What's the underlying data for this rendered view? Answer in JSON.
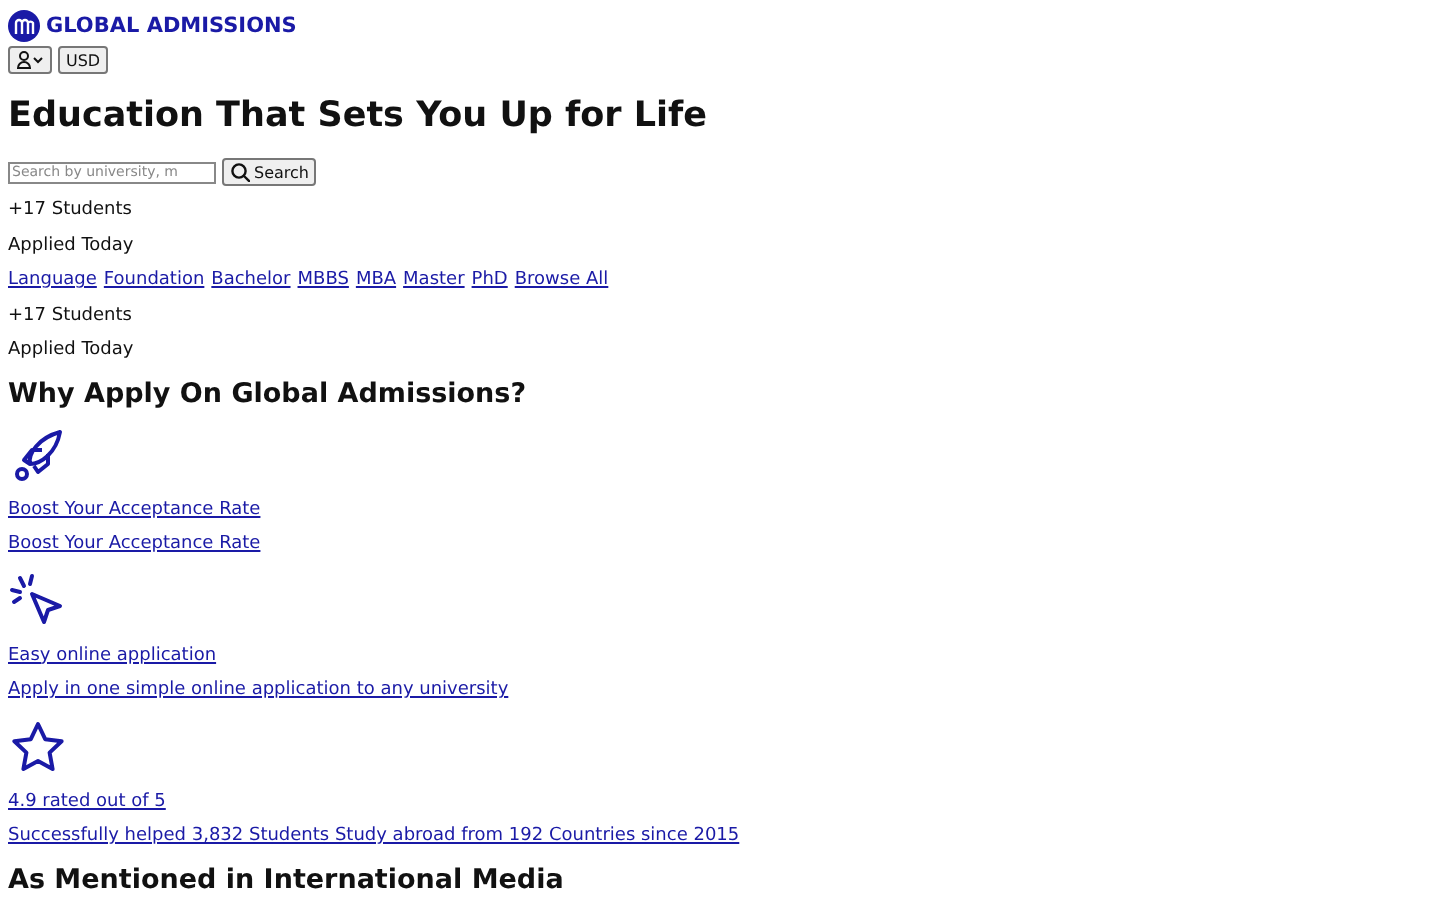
{
  "brand": {
    "name": "GLOBAL ADMISSIONS"
  },
  "header": {
    "currency": "USD"
  },
  "hero": {
    "title": "Education That Sets You Up for Life",
    "search": {
      "placeholder": "Search by university, m",
      "button": "Search"
    }
  },
  "stats_top": [
    {
      "text": "+17 Students"
    },
    {
      "text": "Applied Today"
    }
  ],
  "programs": [
    "Language",
    "Foundation",
    "Bachelor",
    "MBBS",
    "MBA",
    "Master",
    "PhD",
    "Browse All"
  ],
  "stats_bottom": [
    {
      "text": "+17 Students"
    },
    {
      "text": "Applied Today"
    }
  ],
  "why": {
    "title": "Why Apply On Global Admissions?",
    "features": [
      {
        "kind": "rocket",
        "title": "Boost Your Acceptance Rate",
        "text": "Boost Your Acceptance Rate"
      },
      {
        "kind": "click",
        "title": "Easy online application",
        "text": "Apply in one simple online application to any university"
      },
      {
        "kind": "star",
        "title": "4.9 rated out of 5",
        "text": "Successfully helped 3,832 Students Study abroad from 192 Countries since 2015"
      }
    ]
  },
  "media": {
    "title": "As Mentioned in International Media"
  }
}
